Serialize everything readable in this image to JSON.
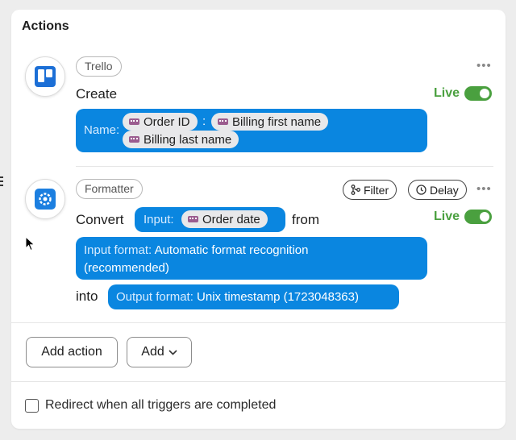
{
  "section_title": "Actions",
  "actions": [
    {
      "app": "Trello",
      "verb": "Create",
      "status": "Live",
      "name_field": {
        "label": "Name:",
        "chips": [
          "Order ID",
          "Billing first name",
          "Billing last name"
        ],
        "separator": ":"
      }
    },
    {
      "app": "Formatter",
      "verb": "Convert",
      "status": "Live",
      "filter_label": "Filter",
      "delay_label": "Delay",
      "input": {
        "label": "Input:",
        "chip": "Order date"
      },
      "from_text": "from",
      "input_format": {
        "label": "Input format:",
        "value_line1": "Automatic format recognition",
        "value_line2": "(recommended)"
      },
      "into_text": "into",
      "output_format": {
        "label": "Output format:",
        "value": "Unix timestamp (1723048363)"
      }
    }
  ],
  "buttons": {
    "add_action": "Add action",
    "add": "Add"
  },
  "redirect": {
    "label": "Redirect when all triggers are completed",
    "checked": false
  },
  "colors": {
    "accent": "#0a86e0",
    "live": "#4aa03f",
    "trello": "#1c6fd6",
    "woo": "#9b5c8f"
  },
  "icons": [
    "trello-logo",
    "formatter-gear-icon",
    "woo-icon",
    "filter-icon",
    "clock-icon",
    "chevron-down-icon",
    "more-dots-icon",
    "pointer-cursor-icon"
  ]
}
